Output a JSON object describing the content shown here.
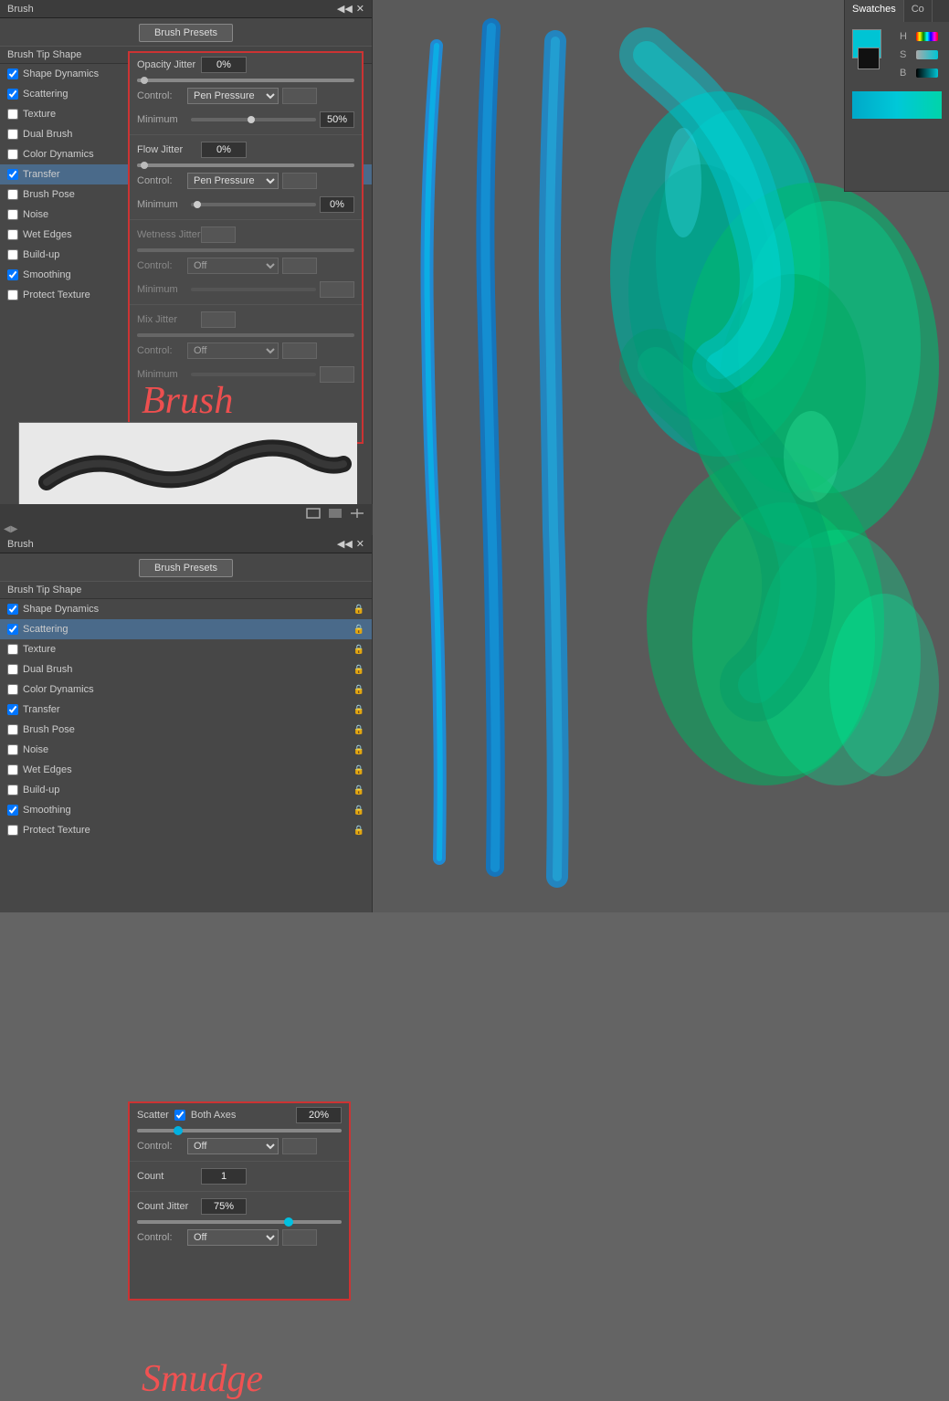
{
  "panels": {
    "top": {
      "title": "Brush",
      "preset_button": "Brush Presets",
      "section_brush_tip": "Brush Tip Shape",
      "items": [
        {
          "label": "Shape Dynamics",
          "checked": true,
          "active": false
        },
        {
          "label": "Scattering",
          "checked": true,
          "active": false
        },
        {
          "label": "Texture",
          "checked": false,
          "active": false
        },
        {
          "label": "Dual Brush",
          "checked": false,
          "active": false
        },
        {
          "label": "Color Dynamics",
          "checked": false,
          "active": false
        },
        {
          "label": "Transfer",
          "checked": true,
          "active": true
        },
        {
          "label": "Brush Pose",
          "checked": false,
          "active": false
        },
        {
          "label": "Noise",
          "checked": false,
          "active": false
        },
        {
          "label": "Wet Edges",
          "checked": false,
          "active": false
        },
        {
          "label": "Build-up",
          "checked": false,
          "active": false
        },
        {
          "label": "Smoothing",
          "checked": true,
          "active": false
        },
        {
          "label": "Protect Texture",
          "checked": false,
          "active": false
        }
      ],
      "settings": {
        "opacity_jitter": {
          "label": "Opacity Jitter",
          "value": "0%"
        },
        "flow_jitter": {
          "label": "Flow Jitter",
          "value": "0%"
        },
        "wetness_jitter": {
          "label": "Wetness Jitter",
          "value": ""
        },
        "mix_jitter": {
          "label": "Mix Jitter",
          "value": ""
        },
        "control_label": "Control:",
        "pen_pressure": "Pen Pressure",
        "minimum_label": "Minimum",
        "minimum_value": "50%",
        "minimum_value2": "0%",
        "off_label": "Off"
      },
      "brush_label": "Brush"
    },
    "bottom": {
      "title": "Brush",
      "preset_button": "Brush Presets",
      "section_brush_tip": "Brush Tip Shape",
      "items": [
        {
          "label": "Shape Dynamics",
          "checked": true,
          "active": false
        },
        {
          "label": "Scattering",
          "checked": true,
          "active": true
        },
        {
          "label": "Texture",
          "checked": false,
          "active": false
        },
        {
          "label": "Dual Brush",
          "checked": false,
          "active": false
        },
        {
          "label": "Color Dynamics",
          "checked": false,
          "active": false
        },
        {
          "label": "Transfer",
          "checked": true,
          "active": false
        },
        {
          "label": "Brush Pose",
          "checked": false,
          "active": false
        },
        {
          "label": "Noise",
          "checked": false,
          "active": false
        },
        {
          "label": "Wet Edges",
          "checked": false,
          "active": false
        },
        {
          "label": "Build-up",
          "checked": false,
          "active": false
        },
        {
          "label": "Smoothing",
          "checked": true,
          "active": false
        },
        {
          "label": "Protect Texture",
          "checked": false,
          "active": false
        }
      ],
      "settings": {
        "scatter_label": "Scatter",
        "both_axes_label": "Both Axes",
        "scatter_checked": true,
        "scatter_value": "20%",
        "control_label": "Control:",
        "off_label": "Off",
        "count_label": "Count",
        "count_value": "1",
        "count_jitter_label": "Count Jitter",
        "count_jitter_value": "75%",
        "control2_label": "Control:",
        "off2_label": "Off"
      },
      "smudge_label": "Smudge"
    }
  },
  "swatches": {
    "tab_label": "Swatches",
    "tab2_label": "Co",
    "h_label": "H",
    "s_label": "S",
    "b_label": "B",
    "fg_color": "#00c4d4",
    "bg_color": "#111111"
  }
}
